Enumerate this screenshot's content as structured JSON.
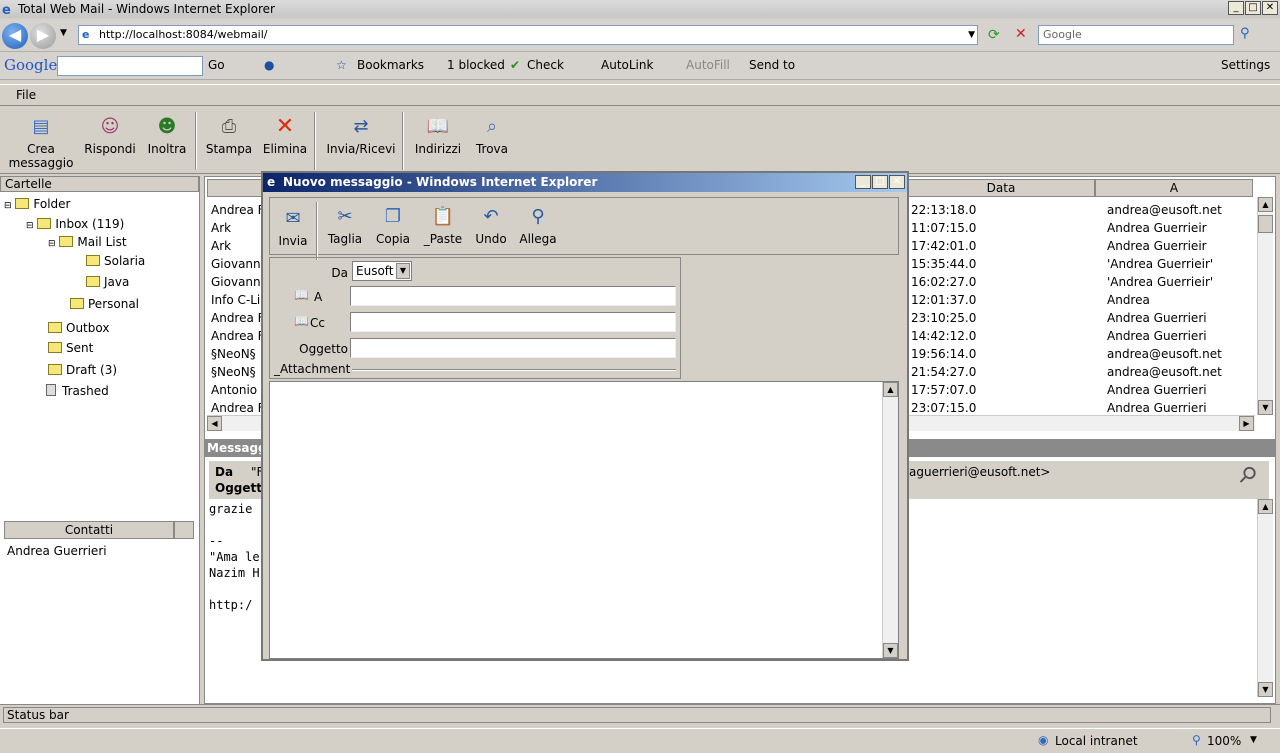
{
  "window": {
    "title": "Total Web Mail - Windows Internet Explorer"
  },
  "address": {
    "url": "http://localhost:8084/webmail/",
    "search_placeholder": "Google"
  },
  "google_bar": {
    "logo": "Google",
    "go": "Go",
    "bookmarks": "Bookmarks",
    "blocked": "1 blocked",
    "check": "Check",
    "autolink": "AutoLink",
    "autofill": "AutoFill",
    "sendto": "Send to",
    "settings": "Settings"
  },
  "menu": {
    "file": "File"
  },
  "toolbar": {
    "crea1": "Crea",
    "crea2": "messaggio",
    "rispondi": "Rispondi",
    "inoltra": "Inoltra",
    "stampa": "Stampa",
    "elimina": "Elimina",
    "invia_ricevi": "Invia/Ricevi",
    "indirizzi": "Indirizzi",
    "trova": "Trova"
  },
  "folders": {
    "header": "Cartelle",
    "items": [
      "Folder",
      "Inbox (119)",
      "Mail List",
      "Solaria",
      "Java",
      "Personal",
      "Outbox",
      "Sent",
      "Draft (3)",
      "Trashed"
    ]
  },
  "contacts": {
    "header": "Contatti",
    "items": [
      "Andrea Guerrieri"
    ]
  },
  "messages": {
    "headers": {
      "data": "Data",
      "a": "A"
    },
    "rows": [
      {
        "from": "Andrea F",
        "date": "22:13:18.0",
        "to": "andrea@eusoft.net"
      },
      {
        "from": "Ark",
        "date": "11:07:15.0",
        "to": "Andrea Guerrieir"
      },
      {
        "from": "Ark",
        "date": "17:42:01.0",
        "to": "Andrea Guerrieir"
      },
      {
        "from": "Giovanni",
        "date": "15:35:44.0",
        "to": "'Andrea Guerrieir'"
      },
      {
        "from": "Giovanni",
        "date": "16:02:27.0",
        "to": "'Andrea Guerrieir'"
      },
      {
        "from": "Info C-Li",
        "date": "12:01:37.0",
        "to": "Andrea"
      },
      {
        "from": "Andrea F",
        "date": "23:10:25.0",
        "to": "Andrea Guerrieri"
      },
      {
        "from": "Andrea F",
        "date": "14:42:12.0",
        "to": "Andrea Guerrieri"
      },
      {
        "from": "§NeoN§",
        "date": "19:56:14.0",
        "to": "andrea@eusoft.net"
      },
      {
        "from": "§NeoN§",
        "date": "21:54:27.0",
        "to": "andrea@eusoft.net"
      },
      {
        "from": "Antonio C",
        "date": "17:57:07.0",
        "to": "Andrea Guerrieri"
      },
      {
        "from": "Andrea F",
        "date": "23:07:15.0",
        "to": "Andrea Guerrieri"
      }
    ]
  },
  "preview": {
    "header": "Messagg",
    "da_label": "Da",
    "da_value": "\"F",
    "oggetto_label": "Oggetto",
    "to_tail": "aguerrieri@eusoft.net>",
    "body": [
      "grazie",
      "",
      "--",
      "\"Ama le",
      "Nazim H",
      "",
      "http:/"
    ]
  },
  "dialog": {
    "title": "Nuovo messaggio - Windows Internet Explorer",
    "invia": "Invia",
    "taglia": "Taglia",
    "copia": "Copia",
    "paste": "_Paste",
    "undo": "Undo",
    "allega": "Allega",
    "da_label": "Da",
    "da_value": "Eusoft",
    "a_label": "A",
    "cc_label": "Cc",
    "oggetto_label": "Oggetto",
    "attachment_label": "_Attachment"
  },
  "status": {
    "text": "Status bar",
    "zone": "Local intranet",
    "zoom": "100%"
  }
}
